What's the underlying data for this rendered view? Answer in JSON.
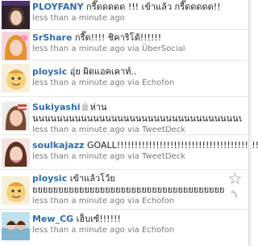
{
  "tweets": [
    {
      "user": "PLOYFANY",
      "text": "กรี๊ดดดดด !!! เข้าแล้ว กรี๊ดดดดด!!",
      "time": "less than a minute ago",
      "via": "",
      "source": "",
      "locked": false,
      "continuation": ""
    },
    {
      "user": "SrShare",
      "text": "กรี๊ด!!!! ชิคาริโต้!!!!!!",
      "time": "less than a minute ago",
      "via": "via",
      "source": "ÜberSocial",
      "locked": false,
      "continuation": ""
    },
    {
      "user": "ploysic",
      "text": "อุ่ย ผิดแอคเคาท์..",
      "time": "less than a minute ago",
      "via": "via",
      "source": "Echofon",
      "locked": false,
      "continuation": ""
    },
    {
      "user": "Sukiyashi",
      "text": "ห่าน",
      "time": "less than a minute ago",
      "via": "via",
      "source": "TweetDeck",
      "locked": true,
      "continuation": "นนนนนนนนนนนนนนนนนนนนนนนนนนนนนนนนนนนนนนนนนนนนนนนนนนนนนนน"
    },
    {
      "user": "soulkajazz",
      "text": "GOALL!!!!!!!!!!!!!!!!!!!!!!!!!!!!!!!!!!!!!!!!!",
      "time": "less than a minute ago",
      "via": "via",
      "source": "TweetDeck",
      "locked": false,
      "continuation": ""
    },
    {
      "user": "ploysic",
      "text": "เข้าแล้วโว้ย",
      "time": "less than a minute ago",
      "via": "via",
      "source": "Echofon",
      "locked": false,
      "continuation": "ยยยยยยยยยยยยยยยยยยยยยยยยยยยยยยยยยยยยยยยยยย"
    },
    {
      "user": "Mew_CG",
      "text": "เฮ็บเซ้!!!!!!",
      "time": "less than a minute ago",
      "via": "via",
      "source": "Echofon",
      "locked": false,
      "continuation": ""
    }
  ],
  "colors": {
    "username": "#2f6da8",
    "meta": "#7a7a7a"
  }
}
